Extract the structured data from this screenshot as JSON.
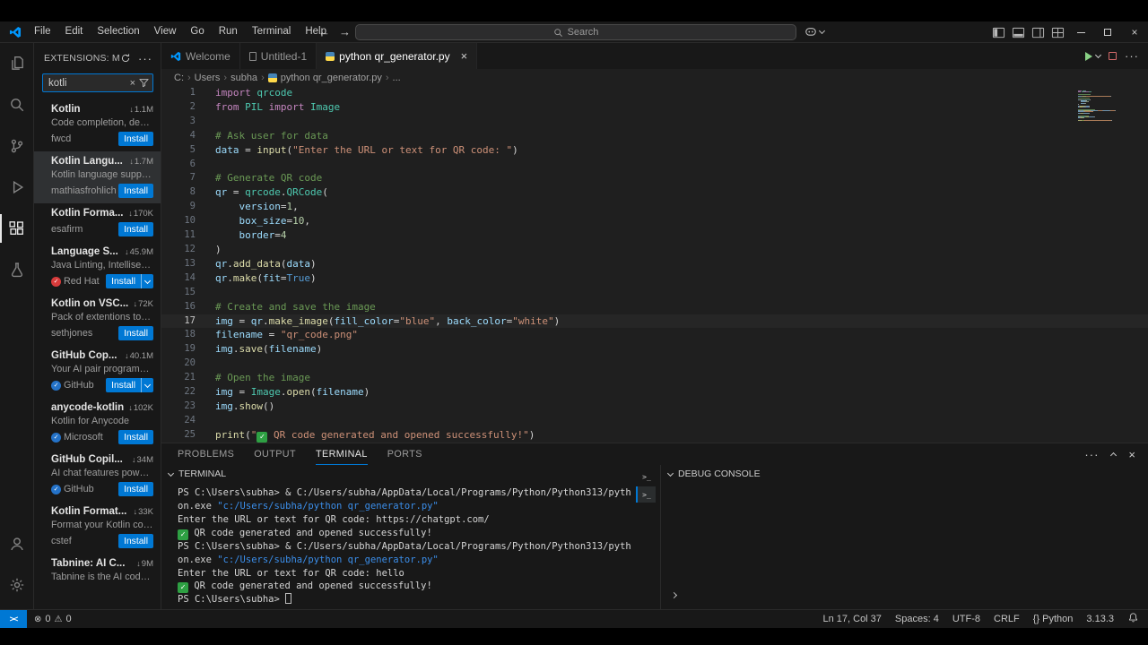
{
  "titlebar": {
    "menus": [
      "File",
      "Edit",
      "Selection",
      "View",
      "Go",
      "Run",
      "Terminal",
      "Help"
    ],
    "search_placeholder": "Search"
  },
  "sidebar": {
    "title": "EXTENSIONS: M...",
    "search_value": "kotli",
    "items": [
      {
        "name": "Kotlin",
        "installs": "1.1M",
        "desc": "Code completion, deb...",
        "publisher": "fwcd",
        "action": "Install",
        "badge": "",
        "dropdown": false,
        "selected": false
      },
      {
        "name": "Kotlin Langu...",
        "installs": "1.7M",
        "desc": "Kotlin language suppo...",
        "publisher": "mathiasfrohlich",
        "action": "Install",
        "badge": "",
        "dropdown": false,
        "selected": true
      },
      {
        "name": "Kotlin Forma...",
        "installs": "170K",
        "desc": "",
        "publisher": "esafirm",
        "action": "Install",
        "badge": "",
        "dropdown": false,
        "selected": false
      },
      {
        "name": "Language S...",
        "installs": "45.9M",
        "desc": "Java Linting, Intellisens...",
        "publisher": "Red Hat",
        "action": "Install",
        "badge": "#d83b3b",
        "dropdown": true,
        "selected": false
      },
      {
        "name": "Kotlin on VSC...",
        "installs": "72K",
        "desc": "Pack of extentions to e...",
        "publisher": "sethjones",
        "action": "Install",
        "badge": "",
        "dropdown": false,
        "selected": false
      },
      {
        "name": "GitHub Cop...",
        "installs": "40.1M",
        "desc": "Your AI pair programm...",
        "publisher": "GitHub",
        "action": "Install",
        "badge": "#2472c8",
        "dropdown": true,
        "selected": false
      },
      {
        "name": "anycode-kotlin",
        "installs": "102K",
        "desc": "Kotlin for Anycode",
        "publisher": "Microsoft",
        "action": "Install",
        "badge": "#2472c8",
        "dropdown": false,
        "selected": false
      },
      {
        "name": "GitHub Copil...",
        "installs": "34M",
        "desc": "AI chat features power...",
        "publisher": "GitHub",
        "action": "Install",
        "badge": "#2472c8",
        "dropdown": false,
        "selected": false
      },
      {
        "name": "Kotlin Format...",
        "installs": "33K",
        "desc": "Format your Kotlin cod...",
        "publisher": "cstef",
        "action": "Install",
        "badge": "",
        "dropdown": false,
        "selected": false
      },
      {
        "name": "Tabnine: AI C...",
        "installs": "9M",
        "desc": "Tabnine is the AI code...",
        "publisher": "",
        "action": "",
        "badge": "",
        "dropdown": false,
        "selected": false
      }
    ]
  },
  "editor": {
    "tabs": [
      {
        "label": "Welcome",
        "icon": "vscode",
        "active": false
      },
      {
        "label": "Untitled-1",
        "icon": "file",
        "active": false
      },
      {
        "label": "python qr_generator.py",
        "icon": "python",
        "active": true
      }
    ],
    "breadcrumb": [
      {
        "label": "C:",
        "icon": ""
      },
      {
        "label": "Users",
        "icon": ""
      },
      {
        "label": "subha",
        "icon": ""
      },
      {
        "label": "python qr_generator.py",
        "icon": "python"
      },
      {
        "label": "...",
        "icon": ""
      }
    ],
    "active_line": 17,
    "lines": [
      [
        [
          "kw",
          "import"
        ],
        [
          "pln",
          " "
        ],
        [
          "mod",
          "qrcode"
        ]
      ],
      [
        [
          "kw",
          "from"
        ],
        [
          "pln",
          " "
        ],
        [
          "mod",
          "PIL"
        ],
        [
          "kw",
          " import "
        ],
        [
          "mod",
          "Image"
        ]
      ],
      [],
      [
        [
          "cmt",
          "# Ask user for data"
        ]
      ],
      [
        [
          "var",
          "data"
        ],
        [
          "pln",
          " = "
        ],
        [
          "fn",
          "input"
        ],
        [
          "pln",
          "("
        ],
        [
          "str",
          "\"Enter the URL or text for QR code: \""
        ],
        [
          "pln",
          ")"
        ]
      ],
      [],
      [
        [
          "cmt",
          "# Generate QR code"
        ]
      ],
      [
        [
          "var",
          "qr"
        ],
        [
          "pln",
          " = "
        ],
        [
          "mod",
          "qrcode"
        ],
        [
          "pln",
          "."
        ],
        [
          "mod",
          "QRCode"
        ],
        [
          "pln",
          "("
        ]
      ],
      [
        [
          "pln",
          "    "
        ],
        [
          "var",
          "version"
        ],
        [
          "pln",
          "="
        ],
        [
          "num",
          "1"
        ],
        [
          "pln",
          ","
        ]
      ],
      [
        [
          "pln",
          "    "
        ],
        [
          "var",
          "box_size"
        ],
        [
          "pln",
          "="
        ],
        [
          "num",
          "10"
        ],
        [
          "pln",
          ","
        ]
      ],
      [
        [
          "pln",
          "    "
        ],
        [
          "var",
          "border"
        ],
        [
          "pln",
          "="
        ],
        [
          "num",
          "4"
        ]
      ],
      [
        [
          "pln",
          ")"
        ]
      ],
      [
        [
          "var",
          "qr"
        ],
        [
          "pln",
          "."
        ],
        [
          "fn",
          "add_data"
        ],
        [
          "pln",
          "("
        ],
        [
          "var",
          "data"
        ],
        [
          "pln",
          ")"
        ]
      ],
      [
        [
          "var",
          "qr"
        ],
        [
          "pln",
          "."
        ],
        [
          "fn",
          "make"
        ],
        [
          "pln",
          "("
        ],
        [
          "var",
          "fit"
        ],
        [
          "pln",
          "="
        ],
        [
          "const",
          "True"
        ],
        [
          "pln",
          ")"
        ]
      ],
      [],
      [
        [
          "cmt",
          "# Create and save the image"
        ]
      ],
      [
        [
          "var",
          "img"
        ],
        [
          "pln",
          " = "
        ],
        [
          "var",
          "qr"
        ],
        [
          "pln",
          "."
        ],
        [
          "fn",
          "make_image"
        ],
        [
          "pln",
          "("
        ],
        [
          "var",
          "fill_color"
        ],
        [
          "pln",
          "="
        ],
        [
          "str",
          "\"blue\""
        ],
        [
          "pln",
          ", "
        ],
        [
          "var",
          "back_color"
        ],
        [
          "pln",
          "="
        ],
        [
          "str",
          "\"white\""
        ],
        [
          "pln",
          ")"
        ]
      ],
      [
        [
          "var",
          "filename"
        ],
        [
          "pln",
          " = "
        ],
        [
          "str",
          "\"qr_code.png\""
        ]
      ],
      [
        [
          "var",
          "img"
        ],
        [
          "pln",
          "."
        ],
        [
          "fn",
          "save"
        ],
        [
          "pln",
          "("
        ],
        [
          "var",
          "filename"
        ],
        [
          "pln",
          ")"
        ]
      ],
      [],
      [
        [
          "cmt",
          "# Open the image"
        ]
      ],
      [
        [
          "var",
          "img"
        ],
        [
          "pln",
          " = "
        ],
        [
          "mod",
          "Image"
        ],
        [
          "pln",
          "."
        ],
        [
          "fn",
          "open"
        ],
        [
          "pln",
          "("
        ],
        [
          "var",
          "filename"
        ],
        [
          "pln",
          ")"
        ]
      ],
      [
        [
          "var",
          "img"
        ],
        [
          "pln",
          "."
        ],
        [
          "fn",
          "show"
        ],
        [
          "pln",
          "()"
        ]
      ],
      [],
      [
        [
          "fn",
          "print"
        ],
        [
          "pln",
          "("
        ],
        [
          "str",
          "\""
        ],
        [
          "emoji",
          "✓"
        ],
        [
          "str",
          " QR code generated and opened successfully!\""
        ],
        [
          "pln",
          ")"
        ]
      ]
    ]
  },
  "panel": {
    "tabs": [
      "PROBLEMS",
      "OUTPUT",
      "TERMINAL",
      "PORTS"
    ],
    "active_tab": "TERMINAL",
    "terminal_title": "TERMINAL",
    "debug_title": "DEBUG CONSOLE",
    "terminal_lines": [
      [
        [
          "pln",
          "PS C:\\Users\\subha> & C:/Users/subha/AppData/Local/Programs/Python/Python313/pyth"
        ]
      ],
      [
        [
          "pln",
          "on.exe "
        ],
        [
          "tstr",
          "\"c:/Users/subha/python qr_generator.py\""
        ]
      ],
      [
        [
          "pln",
          "Enter the URL or text for QR code: https://chatgpt.com/"
        ]
      ],
      [
        [
          "emoji",
          "✓"
        ],
        [
          "pln",
          " QR code generated and opened successfully!"
        ]
      ],
      [
        [
          "pln",
          "PS C:\\Users\\subha> & C:/Users/subha/AppData/Local/Programs/Python/Python313/pyth"
        ]
      ],
      [
        [
          "pln",
          "on.exe "
        ],
        [
          "tstr",
          "\"c:/Users/subha/python qr_generator.py\""
        ]
      ],
      [
        [
          "pln",
          "Enter the URL or text for QR code: hello"
        ]
      ],
      [
        [
          "emoji",
          "✓"
        ],
        [
          "pln",
          " QR code generated and opened successfully!"
        ]
      ],
      [
        [
          "pln",
          "PS C:\\Users\\subha> "
        ],
        [
          "cursor",
          ""
        ]
      ]
    ]
  },
  "statusbar": {
    "errors": "0",
    "warnings": "0",
    "right": [
      "Ln 17, Col 37",
      "Spaces: 4",
      "UTF-8",
      "CRLF",
      "{} Python",
      "3.13.3"
    ]
  }
}
